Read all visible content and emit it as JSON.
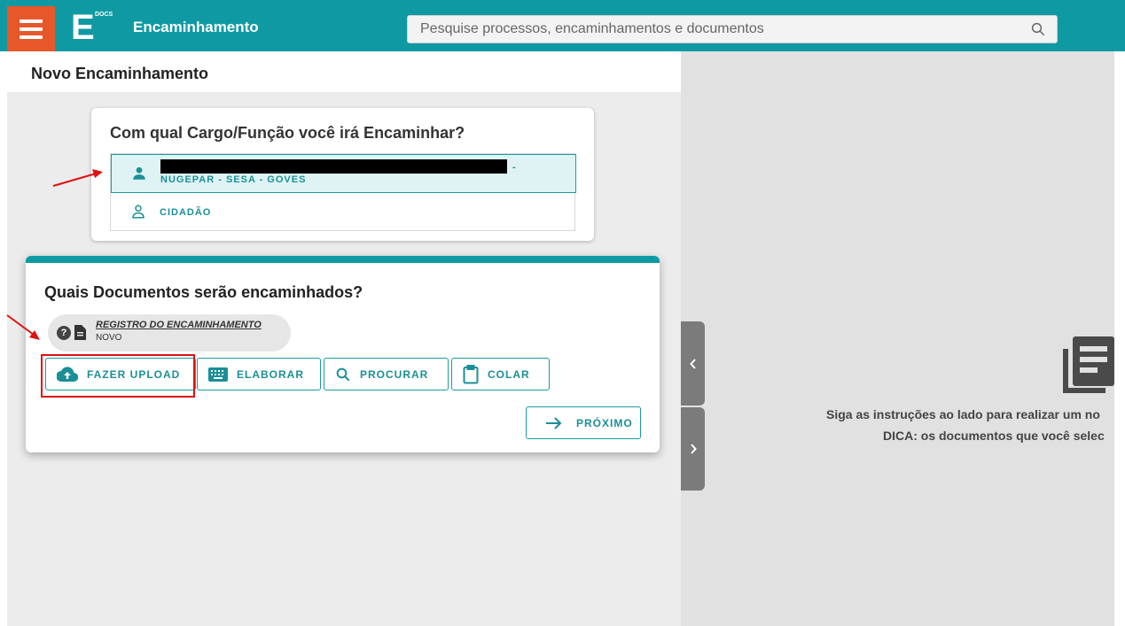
{
  "header": {
    "app_title": "Encaminhamento",
    "logo_letter": "E",
    "logo_sub": "DOCS",
    "search_placeholder": "Pesquise processos, encaminhamentos e documentos",
    "menu_icon": "hamburger-icon",
    "search_icon": "search-icon"
  },
  "page": {
    "title": "Novo Encaminhamento"
  },
  "role_card": {
    "question": "Com qual Cargo/Função você irá Encaminhar?",
    "selected_role": {
      "line1_suffix": "-",
      "line2": "NUGEPAR - SESA - GOVES",
      "icon": "person-filled-icon"
    },
    "other_role": {
      "label": "CIDADÃO",
      "icon": "person-outline-icon"
    }
  },
  "docs_card": {
    "question": "Quais Documentos serão encaminhados?",
    "document": {
      "name": "REGISTRO DO ENCAMINHAMENTO",
      "status": "NOVO"
    },
    "buttons": {
      "upload": "FAZER UPLOAD",
      "elaborar": "ELABORAR",
      "procurar": "PROCURAR",
      "colar": "COLAR",
      "proximo": "PRÓXIMO"
    }
  },
  "right_panel": {
    "instruction_line1": "Siga as instruções ao lado para realizar um no",
    "instruction_line2": "DICA: os documentos que você selec"
  },
  "colors": {
    "accent": "#0f9aa3",
    "menu_orange": "#e8572a",
    "highlight_red": "#e01010"
  }
}
